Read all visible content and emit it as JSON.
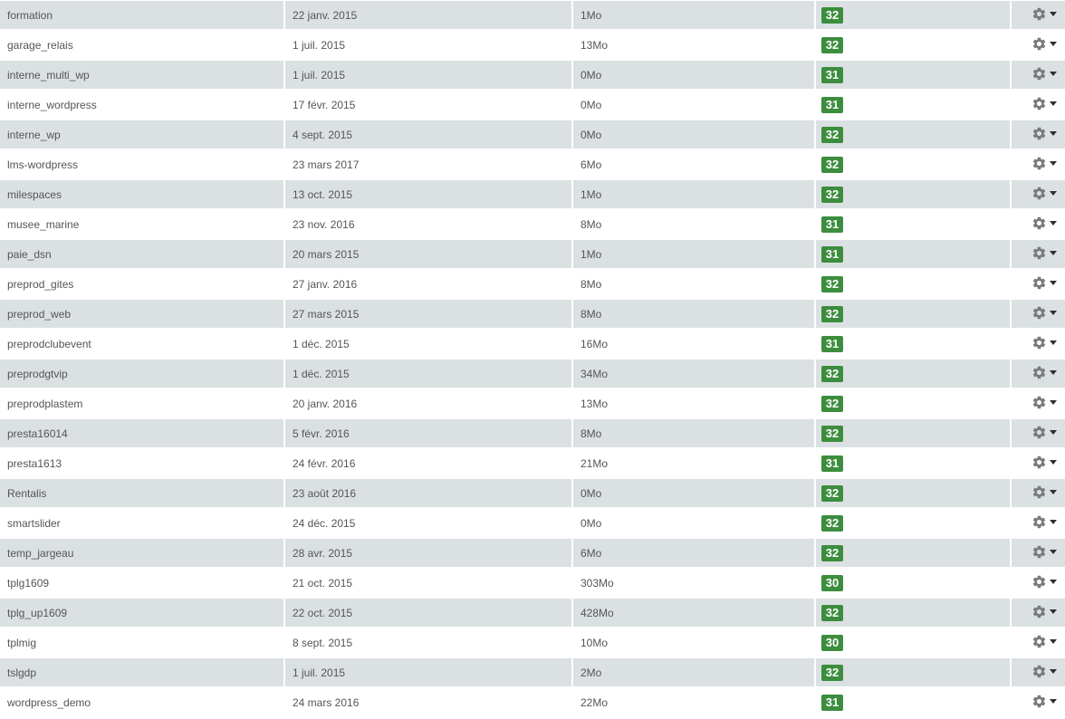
{
  "table": {
    "rows": [
      {
        "name": "formation",
        "date": "22 janv. 2015",
        "size": "1Mo",
        "version": "32"
      },
      {
        "name": "garage_relais",
        "date": "1 juil. 2015",
        "size": "13Mo",
        "version": "32"
      },
      {
        "name": "interne_multi_wp",
        "date": "1 juil. 2015",
        "size": "0Mo",
        "version": "31"
      },
      {
        "name": "interne_wordpress",
        "date": "17 févr. 2015",
        "size": "0Mo",
        "version": "31"
      },
      {
        "name": "interne_wp",
        "date": "4 sept. 2015",
        "size": "0Mo",
        "version": "32"
      },
      {
        "name": "lms-wordpress",
        "date": "23 mars 2017",
        "size": "6Mo",
        "version": "32"
      },
      {
        "name": "milespaces",
        "date": "13 oct. 2015",
        "size": "1Mo",
        "version": "32"
      },
      {
        "name": "musee_marine",
        "date": "23 nov. 2016",
        "size": "8Mo",
        "version": "31"
      },
      {
        "name": "paie_dsn",
        "date": "20 mars 2015",
        "size": "1Mo",
        "version": "31"
      },
      {
        "name": "preprod_gites",
        "date": "27 janv. 2016",
        "size": "8Mo",
        "version": "32"
      },
      {
        "name": "preprod_web",
        "date": "27 mars 2015",
        "size": "8Mo",
        "version": "32"
      },
      {
        "name": "preprodclubevent",
        "date": "1 déc. 2015",
        "size": "16Mo",
        "version": "31"
      },
      {
        "name": "preprodgtvip",
        "date": "1 déc. 2015",
        "size": "34Mo",
        "version": "32"
      },
      {
        "name": "preprodplastem",
        "date": "20 janv. 2016",
        "size": "13Mo",
        "version": "32"
      },
      {
        "name": "presta16014",
        "date": "5 févr. 2016",
        "size": "8Mo",
        "version": "32"
      },
      {
        "name": "presta1613",
        "date": "24 févr. 2016",
        "size": "21Mo",
        "version": "31"
      },
      {
        "name": "Rentalis",
        "date": "23 août 2016",
        "size": "0Mo",
        "version": "32"
      },
      {
        "name": "smartslider",
        "date": "24 déc. 2015",
        "size": "0Mo",
        "version": "32"
      },
      {
        "name": "temp_jargeau",
        "date": "28 avr. 2015",
        "size": "6Mo",
        "version": "32"
      },
      {
        "name": "tplg1609",
        "date": "21 oct. 2015",
        "size": "303Mo",
        "version": "30"
      },
      {
        "name": "tplg_up1609",
        "date": "22 oct. 2015",
        "size": "428Mo",
        "version": "32"
      },
      {
        "name": "tplmig",
        "date": "8 sept. 2015",
        "size": "10Mo",
        "version": "30"
      },
      {
        "name": "tslgdp",
        "date": "1 juil. 2015",
        "size": "2Mo",
        "version": "32"
      },
      {
        "name": "wordpress_demo",
        "date": "24 mars 2016",
        "size": "22Mo",
        "version": "31"
      }
    ],
    "action_icon": "gear-icon",
    "action_caret_icon": "caret-down-icon"
  },
  "colors": {
    "row_stripe": "#dbe0e2",
    "badge_green": "#3c8d3e",
    "gear_gray": "#7a7a7a"
  }
}
